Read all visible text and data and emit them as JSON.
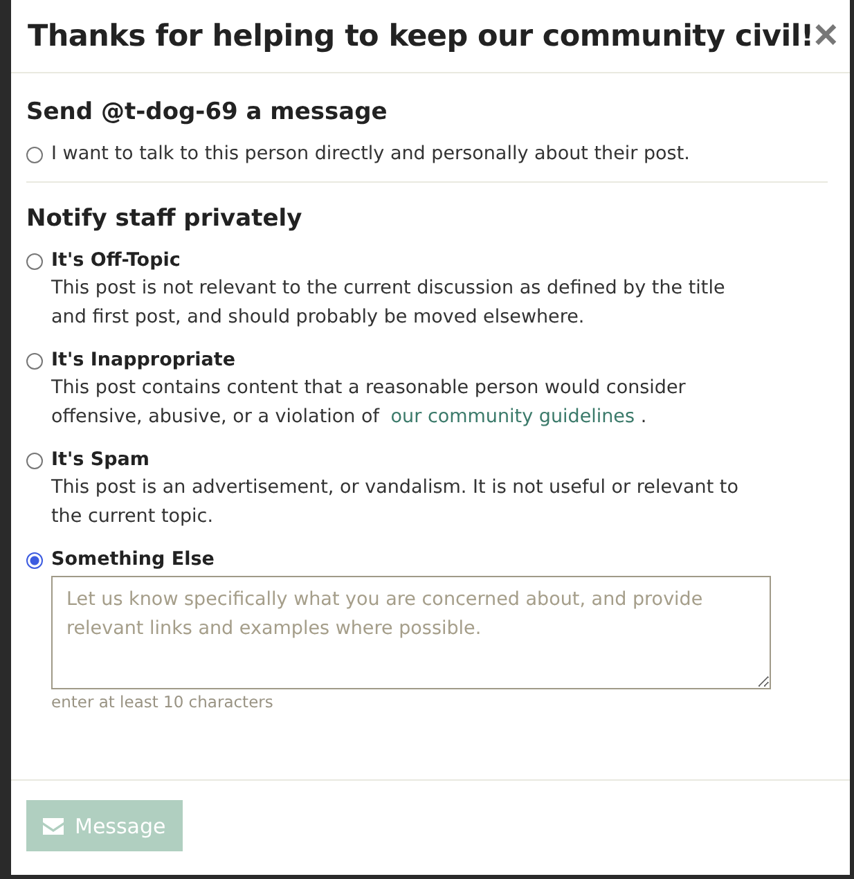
{
  "title": "Thanks for helping to keep our community civil!",
  "close": "×",
  "message_section": {
    "heading": "Send @t-dog-69 a message",
    "option": {
      "label": "I want to talk to this person directly and personally about their post.",
      "selected": false
    }
  },
  "staff_section": {
    "heading": "Notify staff privately",
    "options": [
      {
        "title": "It's Off-Topic",
        "description": "This post is not relevant to the current discussion as defined by the title and first post, and should probably be moved elsewhere.",
        "selected": false
      },
      {
        "title": "It's Inappropriate",
        "description": "This post contains content that a reasonable person would consider offensive, abusive, or a violation of ",
        "link": "our community guidelines",
        "after": " .",
        "selected": false
      },
      {
        "title": "It's Spam",
        "description": "This post is an advertisement, or vandalism. It is not useful or relevant to the current topic.",
        "selected": false
      },
      {
        "title": "Something Else",
        "selected": true,
        "textarea": {
          "placeholder": "Let us know specifically what you are concerned about, and provide relevant links and examples where possible."
        },
        "hint": "enter at least 10 characters"
      }
    ]
  },
  "button": {
    "label": "Message",
    "disabled": true
  }
}
